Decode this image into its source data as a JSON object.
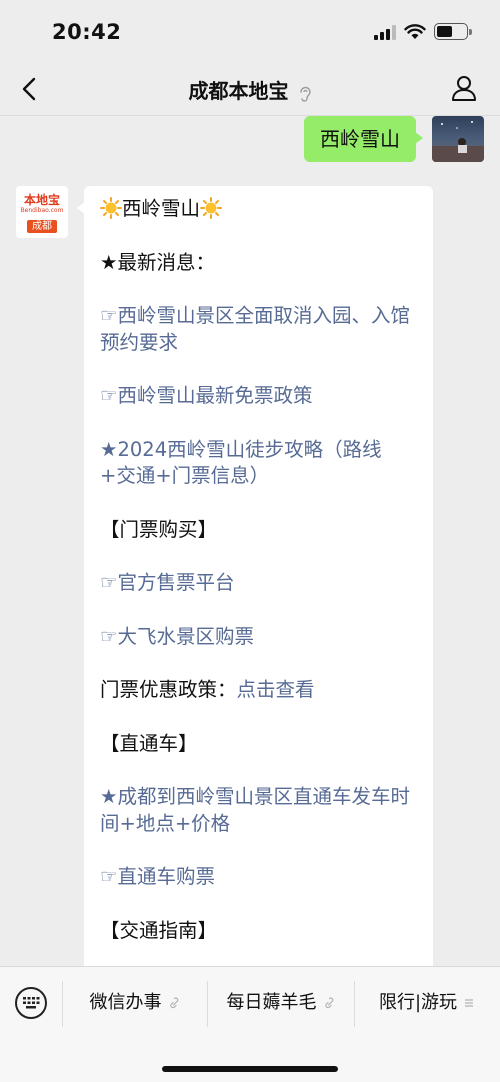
{
  "status_bar": {
    "time": "20:42"
  },
  "nav": {
    "title": "成都本地宝"
  },
  "chat": {
    "my_message": "西岭雪山",
    "bot_avatar": {
      "line1": "本地宝",
      "line2": "Bendibao.com",
      "line3": "成都"
    },
    "bot": {
      "title": "西岭雪山",
      "latest_heading": "★最新消息：",
      "link1": "☞西岭雪山景区全面取消入园、入馆预约要求",
      "link2": "☞西岭雪山最新免票政策",
      "link3": "★2024西岭雪山徒步攻略（路线+交通+门票信息）",
      "tickets_heading": "【门票购买】",
      "link4": "☞官方售票平台",
      "link5": "☞大飞水景区购票",
      "policy_label": "门票优惠政策：",
      "policy_link": "点击查看",
      "bus_heading": "【直通车】",
      "link6": "★成都到西岭雪山景区直通车发车时间+地点+价格",
      "link7": "☞直通车购票",
      "traffic_heading": "【交通指南】"
    }
  },
  "bottom_menu": {
    "items": [
      {
        "label": "微信办事",
        "icon": "link-icon"
      },
      {
        "label": "每日薅羊毛",
        "icon": "link-icon"
      },
      {
        "label": "限行|游玩",
        "icon": "menu-icon"
      }
    ]
  },
  "colors": {
    "link": "#576b95",
    "my_bubble": "#95ec69",
    "background": "#ededed"
  }
}
